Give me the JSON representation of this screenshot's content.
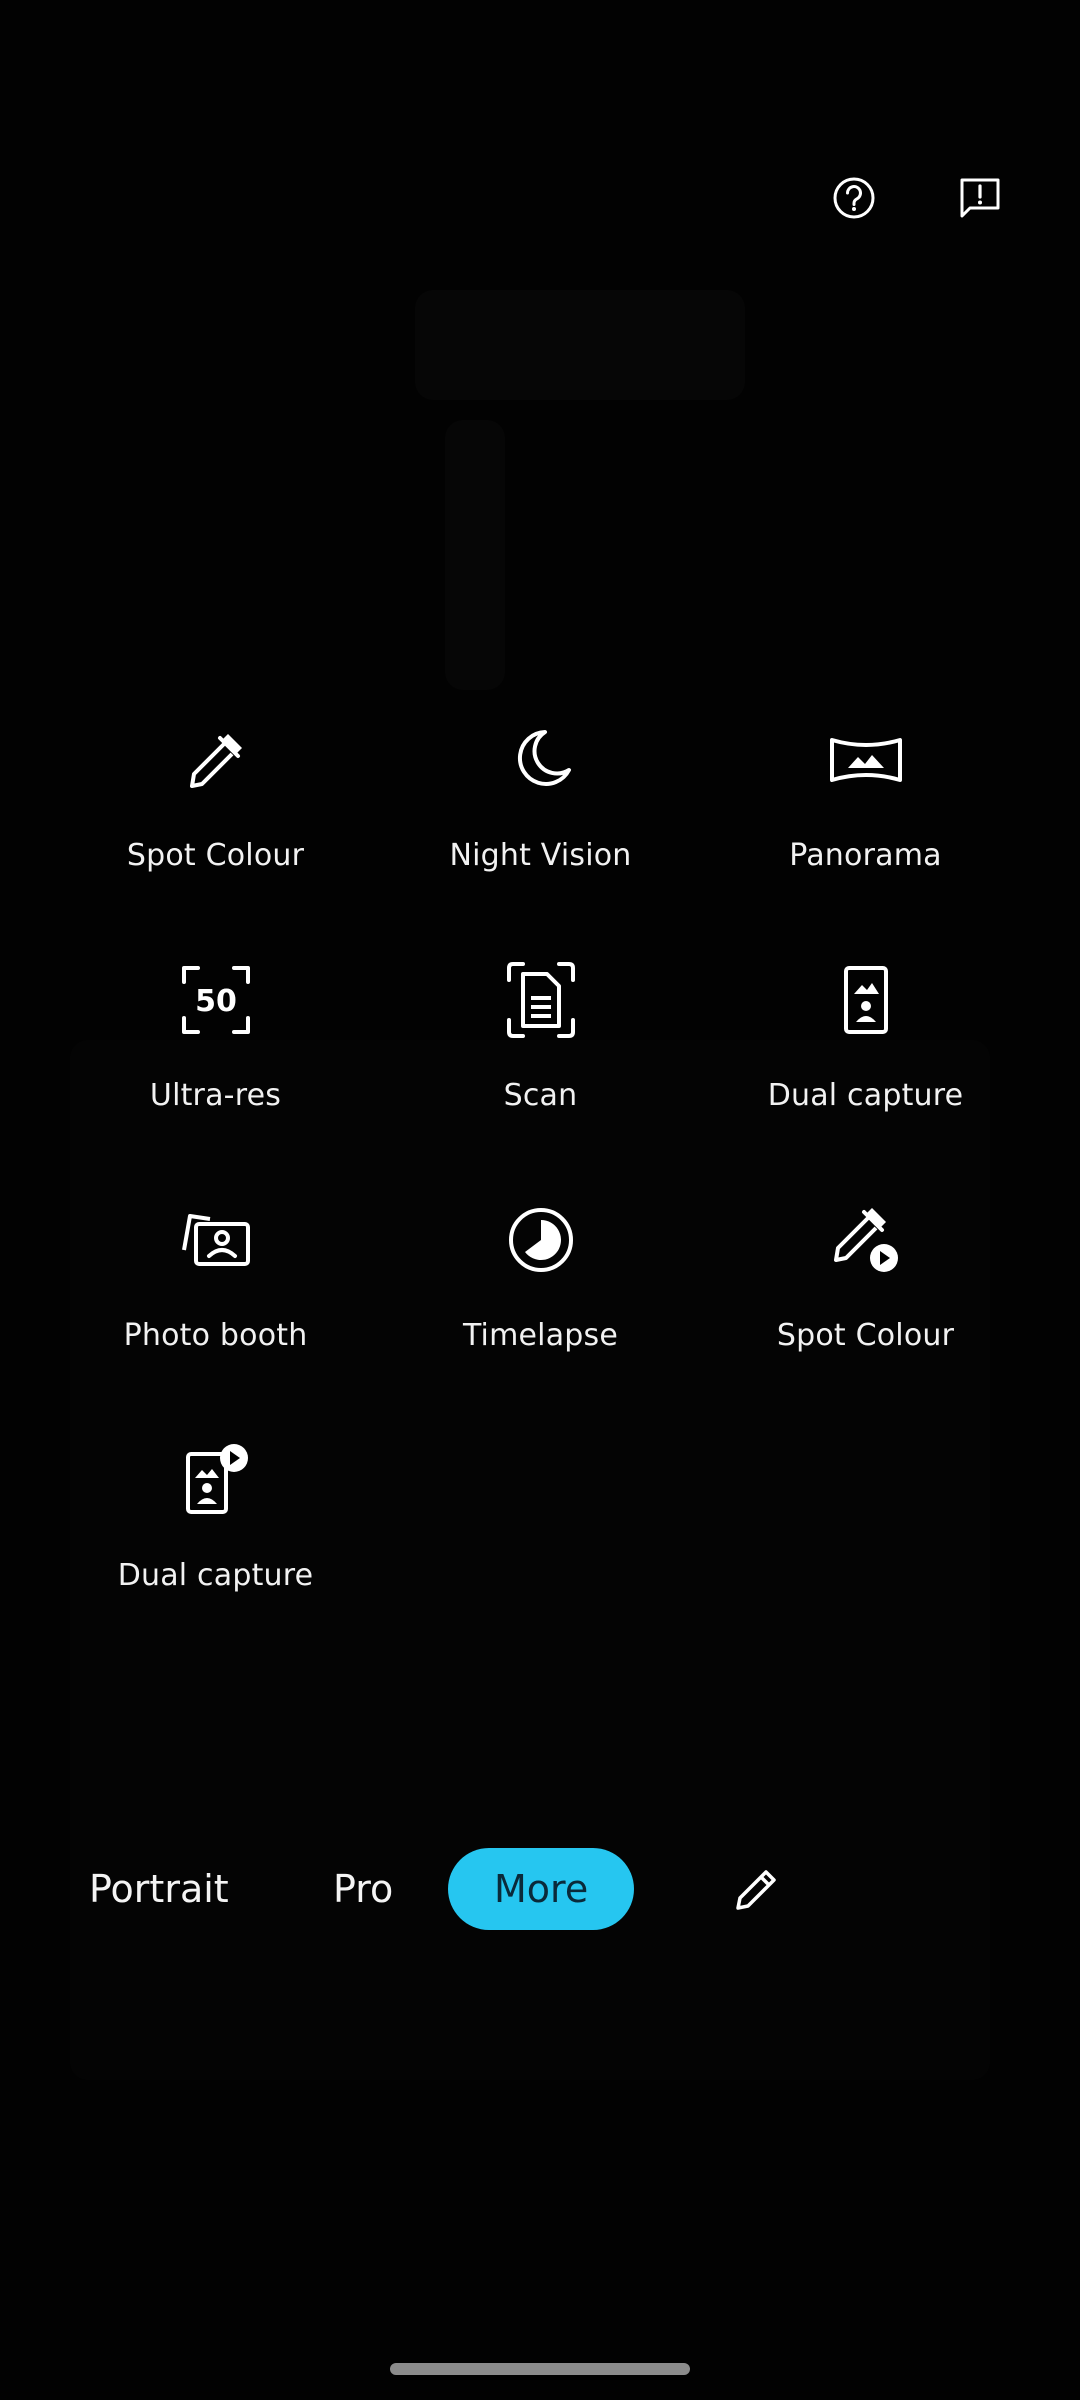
{
  "top_bar": {
    "help_icon": "help-circle-icon",
    "feedback_icon": "feedback-icon"
  },
  "modes": [
    {
      "label": "Spot Colour",
      "icon": "eyedropper-icon"
    },
    {
      "label": "Night Vision",
      "icon": "moon-icon"
    },
    {
      "label": "Panorama",
      "icon": "panorama-icon"
    },
    {
      "label": "Ultra-res",
      "icon": "ultra-res-50-icon",
      "icon_text": "50"
    },
    {
      "label": "Scan",
      "icon": "document-scan-icon"
    },
    {
      "label": "Dual capture",
      "icon": "dual-capture-icon"
    },
    {
      "label": "Photo booth",
      "icon": "photo-booth-icon"
    },
    {
      "label": "Timelapse",
      "icon": "timelapse-icon"
    },
    {
      "label": "Spot Colour",
      "icon": "eyedropper-video-icon"
    },
    {
      "label": "Dual capture",
      "icon": "dual-capture-video-icon"
    }
  ],
  "bottom_tabs": {
    "portrait": "Portrait",
    "pro": "Pro",
    "more": "More",
    "edit_icon": "pencil-icon"
  },
  "colors": {
    "accent": "#26c6f0",
    "background": "#000000"
  }
}
